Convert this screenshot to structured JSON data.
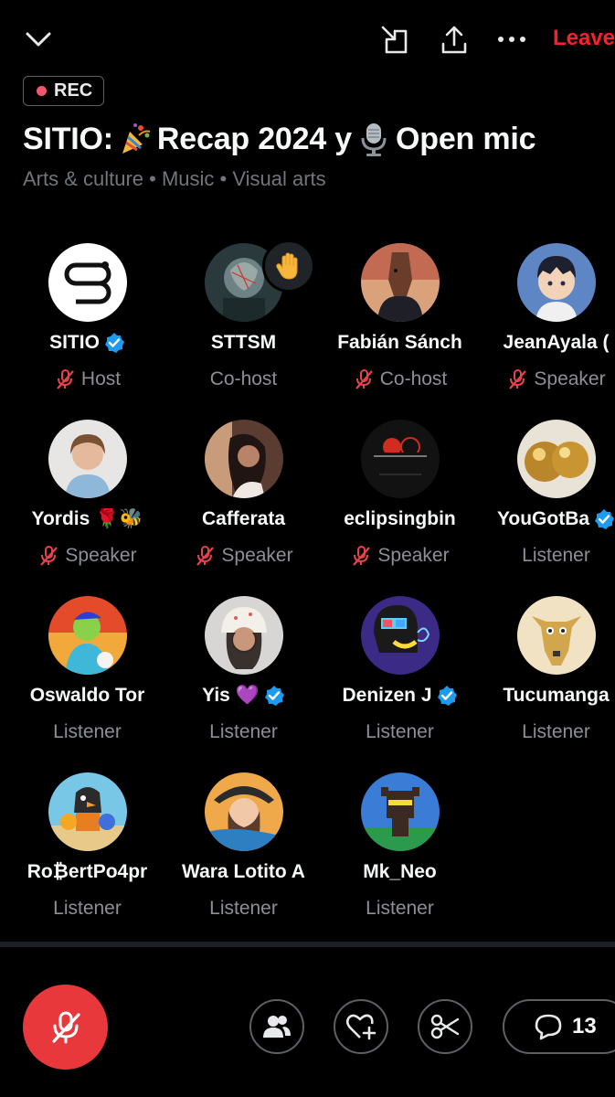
{
  "header": {
    "collapse_icon": "chevron-down-icon",
    "minimize_icon": "minimize-icon",
    "share_icon": "share-icon",
    "more_icon": "more-horizontal-icon",
    "leave_label": "Leave"
  },
  "space": {
    "rec_label": "REC",
    "title_part1": "SITIO: ",
    "title_emoji1": "party-popper-icon",
    "title_part2": "Recap 2024 y ",
    "title_emoji2": "microphone-icon",
    "title_part3": "Open mic",
    "topics": "Arts & culture • Music • Visual arts"
  },
  "participants": [
    {
      "name": "SITIO",
      "role": "Host",
      "verified": true,
      "muted": true
    },
    {
      "name": "STTSM",
      "role": "Co-host",
      "muted": false,
      "hand_raised": true
    },
    {
      "name": "Fabián Sánch",
      "role": "Co-host",
      "muted": true
    },
    {
      "name": "JeanAyala (",
      "role": "Speaker",
      "muted": true
    },
    {
      "name": "Yordis 🌹🐝",
      "role": "Speaker",
      "muted": true
    },
    {
      "name": "Cafferata",
      "role": "Speaker",
      "muted": true
    },
    {
      "name": "eclipsingbin",
      "role": "Speaker",
      "muted": true
    },
    {
      "name": "YouGotBa",
      "role": "Listener",
      "verified": true
    },
    {
      "name": "Oswaldo Tor",
      "role": "Listener"
    },
    {
      "name": "Yis 💜",
      "role": "Listener",
      "verified": true
    },
    {
      "name": "Denizen J",
      "role": "Listener",
      "verified": true
    },
    {
      "name": "Tucumanga",
      "role": "Listener"
    },
    {
      "name": "Ro₿ertPo4pr",
      "role": "Listener"
    },
    {
      "name": "Wara Lotito A",
      "role": "Listener"
    },
    {
      "name": "Mk_Neo",
      "role": "Listener"
    }
  ],
  "footer": {
    "mic_icon": "mic-off-icon",
    "people_icon": "people-icon",
    "heart_icon": "heart-plus-icon",
    "clip_icon": "scissors-icon",
    "comment_icon": "comment-icon",
    "comment_count": "13"
  },
  "colors": {
    "background": "#000000",
    "leave": "#f4212e",
    "rec_dot": "#f4566b",
    "muted_icon": "#e8434b",
    "verified": "#1d9bf0",
    "mic_button": "#e8383c"
  }
}
